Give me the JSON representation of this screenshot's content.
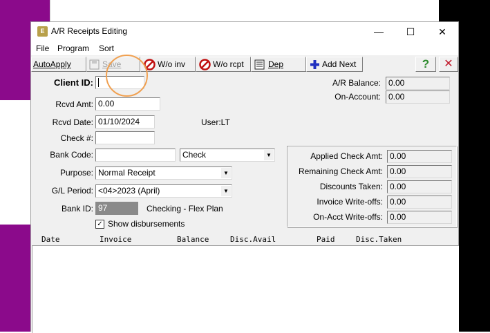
{
  "window": {
    "title": "A/R Receipts Editing",
    "app_icon": "E"
  },
  "window_controls": {
    "minimize": "—",
    "maximize": "☐",
    "close": "✕"
  },
  "menu": [
    "File",
    "Program",
    "Sort"
  ],
  "toolbar": {
    "autoapply": "AutoApply",
    "save": "Save",
    "wo_inv": "W/o inv",
    "wo_rcpt": "W/o rcpt",
    "dep": "Dep",
    "add_next": "Add Next",
    "help": "?",
    "close": "✕"
  },
  "form": {
    "client_id_label": "Client ID:",
    "client_id_value": "",
    "rcvd_amt_label": "Rcvd Amt:",
    "rcvd_amt_value": "0.00",
    "rcvd_date_label": "Rcvd Date:",
    "rcvd_date_value": "01/10/2024",
    "user_text": "User:LT",
    "check_no_label": "Check #:",
    "check_no_value": "",
    "bank_code_label": "Bank Code:",
    "bank_code_value": "",
    "payment_type_value": "Check",
    "purpose_label": "Purpose:",
    "purpose_value": "Normal Receipt",
    "gl_period_label": "G/L Period:",
    "gl_period_value": "<04>2023 (April)",
    "bank_id_label": "Bank ID:",
    "bank_id_value": "97",
    "bank_name": "Checking - Flex Plan",
    "show_disbursements_label": "Show disbursements",
    "show_disbursements_checked": "✓"
  },
  "balances": {
    "ar_balance_label": "A/R Balance:",
    "ar_balance_value": "0.00",
    "on_account_label": "On-Account:",
    "on_account_value": "0.00"
  },
  "summary": {
    "applied_label": "Applied Check Amt:",
    "applied_value": "0.00",
    "remaining_label": "Remaining Check Amt:",
    "remaining_value": "0.00",
    "discounts_label": "Discounts Taken:",
    "discounts_value": "0.00",
    "inv_writeoffs_label": "Invoice Write-offs:",
    "inv_writeoffs_value": "0.00",
    "onacct_writeoffs_label": "On-Acct Write-offs:",
    "onacct_writeoffs_value": "0.00"
  },
  "grid": {
    "columns": [
      "Date",
      "Invoice",
      "Balance",
      "Disc.Avail",
      "Paid",
      "Disc.Taken"
    ]
  },
  "colors": {
    "desktop_accent": "#8b0a8b",
    "highlight_ring": "#f0a050",
    "help_icon": "#2e8b2e",
    "close_icon": "#c0182a",
    "add_icon": "#2030c0",
    "no_icon": "#c01010"
  }
}
